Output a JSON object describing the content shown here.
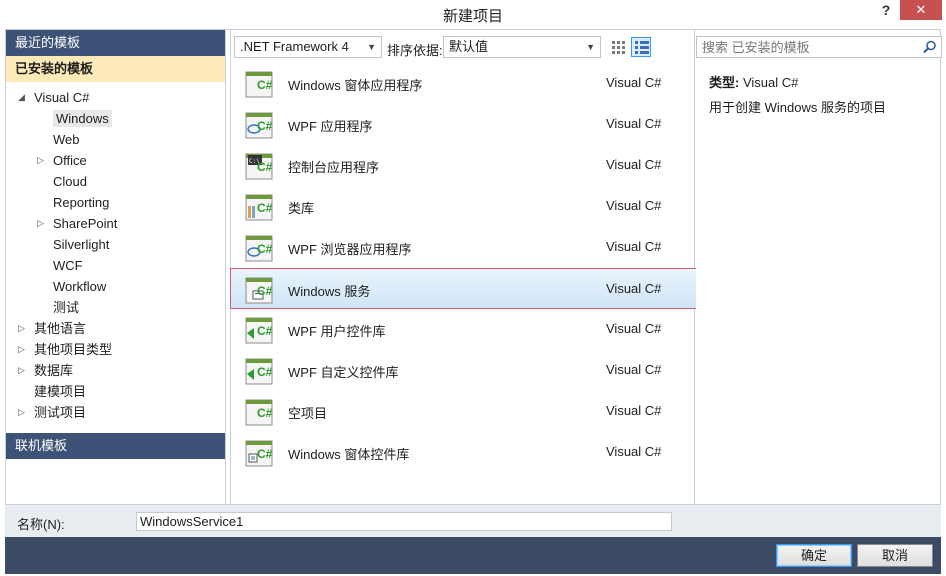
{
  "window": {
    "title": "新建项目",
    "help_glyph": "?",
    "close_glyph": "✕"
  },
  "sidebar": {
    "recent_label": "最近的模板",
    "installed_label": "已安装的模板",
    "online_label": "联机模板",
    "tree": [
      {
        "label": "Visual C#",
        "indent": 0,
        "arrow": "◢"
      },
      {
        "label": "Windows",
        "indent": 1,
        "arrow": "",
        "selected": true
      },
      {
        "label": "Web",
        "indent": 1,
        "arrow": ""
      },
      {
        "label": "Office",
        "indent": 1,
        "arrow": "▷"
      },
      {
        "label": "Cloud",
        "indent": 1,
        "arrow": ""
      },
      {
        "label": "Reporting",
        "indent": 1,
        "arrow": ""
      },
      {
        "label": "SharePoint",
        "indent": 1,
        "arrow": "▷"
      },
      {
        "label": "Silverlight",
        "indent": 1,
        "arrow": ""
      },
      {
        "label": "WCF",
        "indent": 1,
        "arrow": ""
      },
      {
        "label": "Workflow",
        "indent": 1,
        "arrow": ""
      },
      {
        "label": "测试",
        "indent": 1,
        "arrow": ""
      },
      {
        "label": "其他语言",
        "indent": 0,
        "arrow": "▷"
      },
      {
        "label": "其他项目类型",
        "indent": 0,
        "arrow": "▷"
      },
      {
        "label": "数据库",
        "indent": 0,
        "arrow": "▷"
      },
      {
        "label": "建模项目",
        "indent": 0,
        "arrow": ""
      },
      {
        "label": "测试项目",
        "indent": 0,
        "arrow": "▷"
      }
    ]
  },
  "toolbar": {
    "framework_value": ".NET Framework 4",
    "sort_label": "排序依据:",
    "sort_value": "默认值"
  },
  "templates": [
    {
      "name": "Windows 窗体应用程序",
      "lang": "Visual C#",
      "icon": "winforms-app-icon"
    },
    {
      "name": "WPF 应用程序",
      "lang": "Visual C#",
      "icon": "wpf-app-icon"
    },
    {
      "name": "控制台应用程序",
      "lang": "Visual C#",
      "icon": "console-app-icon"
    },
    {
      "name": "类库",
      "lang": "Visual C#",
      "icon": "class-library-icon"
    },
    {
      "name": "WPF 浏览器应用程序",
      "lang": "Visual C#",
      "icon": "wpf-browser-app-icon"
    },
    {
      "name": "Windows 服务",
      "lang": "Visual C#",
      "icon": "windows-service-icon",
      "selected": true
    },
    {
      "name": "WPF 用户控件库",
      "lang": "Visual C#",
      "icon": "wpf-user-control-library-icon"
    },
    {
      "name": "WPF 自定义控件库",
      "lang": "Visual C#",
      "icon": "wpf-custom-control-library-icon"
    },
    {
      "name": "空项目",
      "lang": "Visual C#",
      "icon": "empty-project-icon"
    },
    {
      "name": "Windows 窗体控件库",
      "lang": "Visual C#",
      "icon": "winforms-control-library-icon"
    }
  ],
  "details": {
    "search_placeholder": "搜索 已安装的模板",
    "type_label": "类型:",
    "type_value": "Visual C#",
    "description": "用于创建 Windows 服务的项目"
  },
  "footer": {
    "name_label": "名称(N):",
    "name_value": "WindowsService1",
    "ok_label": "确定",
    "cancel_label": "取消"
  },
  "colors": {
    "nav_header_bg": "#3d5277",
    "installed_bg": "#fcebb8",
    "button_bar_bg": "#3b4b66",
    "selection_border": "#d65c6c",
    "close_bg": "#c75050",
    "icon_green": "#2d9a2d"
  }
}
